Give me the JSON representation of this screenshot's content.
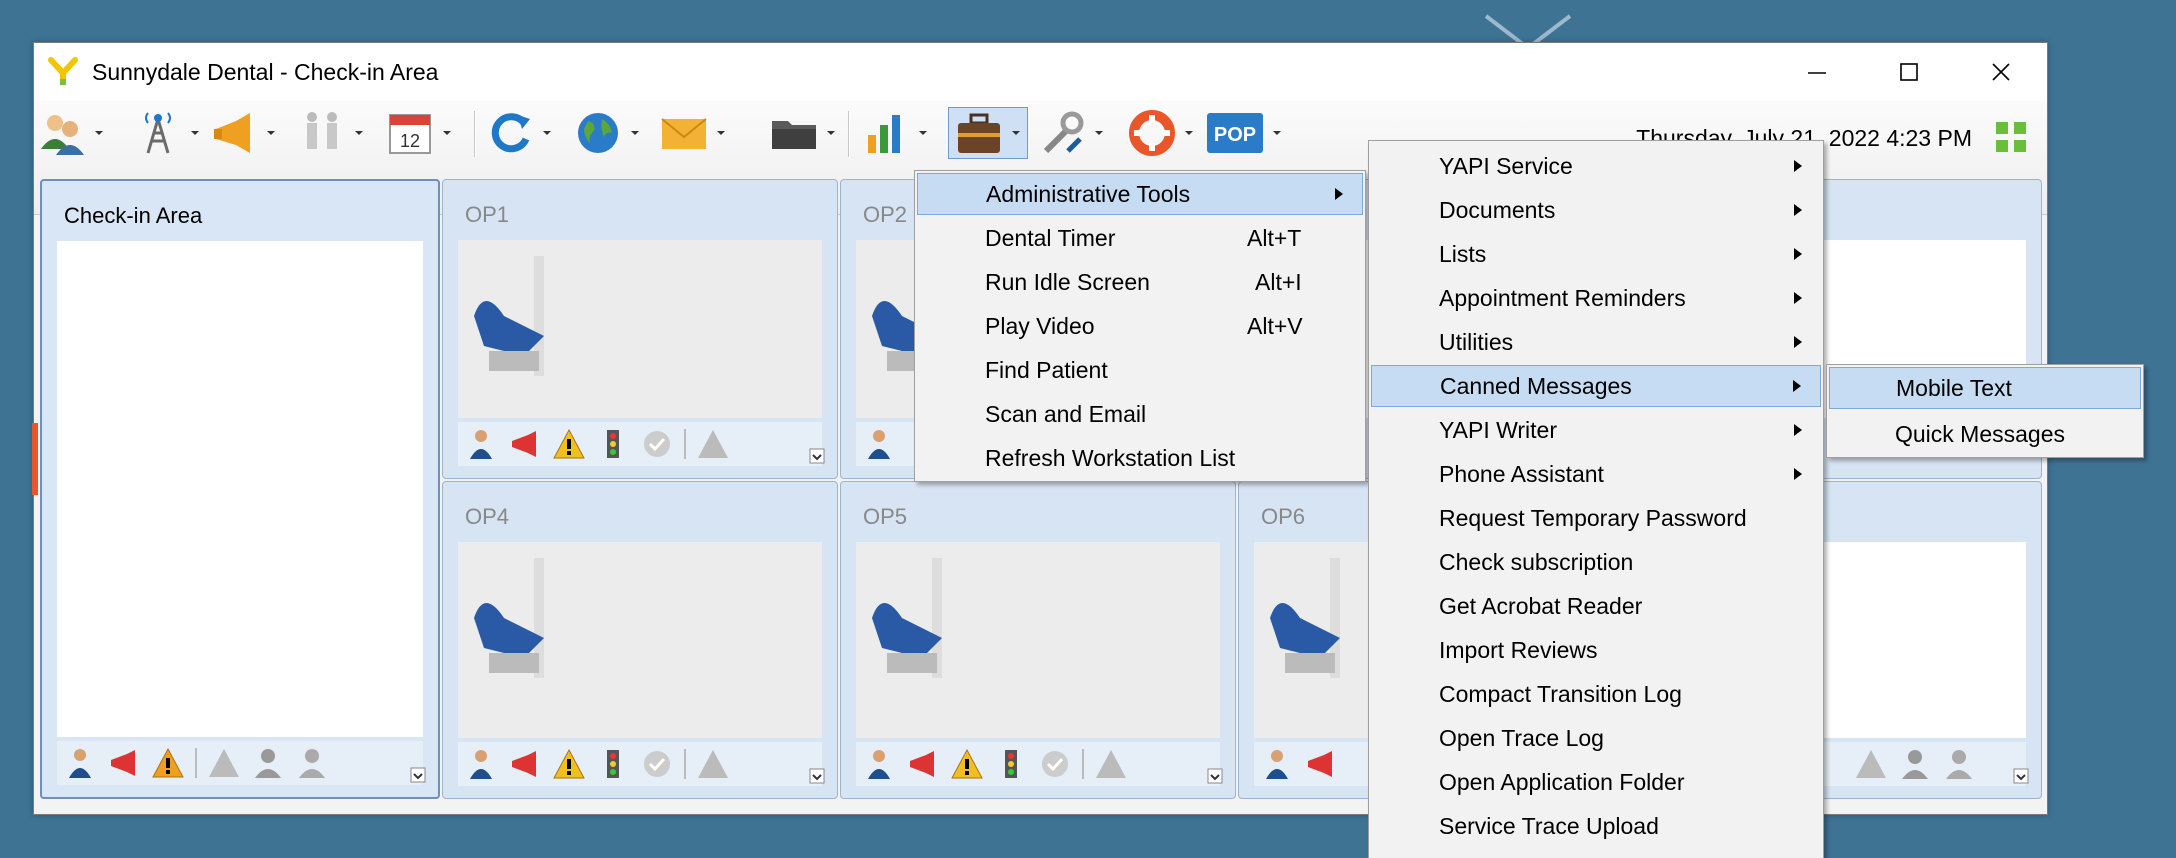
{
  "window": {
    "title": "Sunnydale Dental - Check-in Area",
    "datetime": "Thursday, July 21, 2022 4:23 PM"
  },
  "toolbar": {
    "icons": [
      "users-icon",
      "tower-icon",
      "megaphone-icon",
      "people-icon",
      "calendar-icon",
      "refresh-icon",
      "globe-icon",
      "mail-icon",
      "folder-icon",
      "chart-icon",
      "briefcase-icon",
      "tools-icon",
      "lifebuoy-icon",
      "pop-icon"
    ],
    "calendar_day": "12",
    "pop_label": "POP"
  },
  "panels": {
    "checkin": "Check-in Area",
    "op1": "OP1",
    "op2": "OP2",
    "op4": "OP4",
    "op5": "OP5",
    "op6": "OP6"
  },
  "menu_tools": {
    "items": [
      {
        "label": "Administrative Tools",
        "shortcut": ""
      },
      {
        "label": "Dental Timer",
        "shortcut": "Alt+T"
      },
      {
        "label": "Run Idle Screen",
        "shortcut": "Alt+I"
      },
      {
        "label": "Play Video",
        "shortcut": "Alt+V"
      },
      {
        "label": "Find Patient",
        "shortcut": ""
      },
      {
        "label": "Scan and Email",
        "shortcut": ""
      },
      {
        "label": "Refresh Workstation List",
        "shortcut": ""
      }
    ]
  },
  "menu_admin": {
    "items": [
      {
        "label": "YAPI Service"
      },
      {
        "label": "Documents"
      },
      {
        "label": "Lists"
      },
      {
        "label": "Appointment Reminders"
      },
      {
        "label": "Utilities"
      },
      {
        "label": "Canned Messages"
      },
      {
        "label": "YAPI Writer"
      },
      {
        "label": "Phone Assistant"
      },
      {
        "label": "Request Temporary Password"
      },
      {
        "label": "Check subscription"
      },
      {
        "label": "Get Acrobat Reader"
      },
      {
        "label": "Import Reviews"
      },
      {
        "label": "Compact Transition Log"
      },
      {
        "label": "Open Trace Log"
      },
      {
        "label": "Open Application Folder"
      },
      {
        "label": "Service Trace Upload"
      }
    ]
  },
  "menu_canned": {
    "items": [
      {
        "label": "Mobile Text"
      },
      {
        "label": "Quick Messages"
      }
    ]
  },
  "colors": {
    "desktop": "#3e7394",
    "highlight": "#c5dcf3",
    "accent_orange": "#e8562a"
  }
}
